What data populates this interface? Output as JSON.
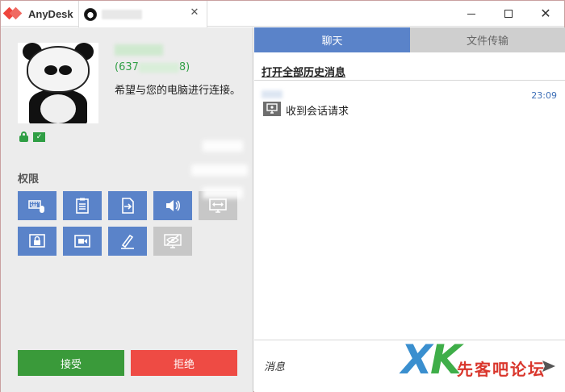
{
  "titlebar": {
    "app_name": "AnyDesk",
    "close_tab_glyph": "✕",
    "close_window_glyph": "✕"
  },
  "session": {
    "user_id_prefix": "(637",
    "user_id_suffix": "8)",
    "request_message": "希望与您的电脑进行连接。"
  },
  "permissions": {
    "title": "权限",
    "items": [
      {
        "name": "keyboard-mouse",
        "icon": "keyboard-mouse-icon",
        "enabled": true
      },
      {
        "name": "clipboard",
        "icon": "clipboard-icon",
        "enabled": true
      },
      {
        "name": "file-transfer",
        "icon": "file-transfer-icon",
        "enabled": true
      },
      {
        "name": "sound",
        "icon": "speaker-icon",
        "enabled": true
      },
      {
        "name": "control-screen",
        "icon": "screen-arrows-icon",
        "enabled": false
      },
      {
        "name": "lock-desktop",
        "icon": "lock-screen-icon",
        "enabled": true
      },
      {
        "name": "record-session",
        "icon": "camera-icon",
        "enabled": true
      },
      {
        "name": "draw",
        "icon": "pen-icon",
        "enabled": true
      },
      {
        "name": "privacy",
        "icon": "eye-hidden-icon",
        "enabled": false
      }
    ]
  },
  "actions": {
    "accept_label": "接受",
    "reject_label": "拒绝"
  },
  "chat": {
    "tabs": [
      {
        "label": "聊天",
        "active": true
      },
      {
        "label": "文件传输",
        "active": false
      }
    ],
    "history_link": "打开全部历史消息",
    "messages": [
      {
        "time": "23:09",
        "text": "收到会话请求"
      }
    ],
    "input_placeholder": "消息"
  },
  "watermark": {
    "logo_letters": "XK",
    "text": "先客吧论坛"
  },
  "colors": {
    "accent_blue": "#5a83c9",
    "accept_green": "#3a9a3a",
    "reject_red": "#ee4b44",
    "id_green": "#2f9e44",
    "disabled_gray": "#c7c7c7"
  }
}
